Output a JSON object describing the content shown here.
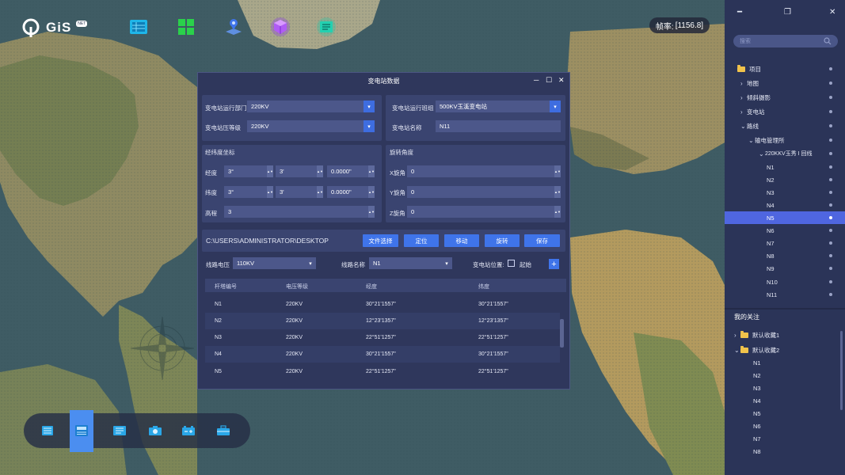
{
  "app": {
    "logo_text": "GiS",
    "logo_tag": "NET",
    "fps_label": "帧率:",
    "fps_value": "[1156.8]"
  },
  "top_icons": [
    "layers-icon",
    "grid-icon",
    "map-pin-icon",
    "cube-icon",
    "document-icon"
  ],
  "colors": {
    "accent": "#3f74ea",
    "selected": "#4f66e0",
    "sidebar_bg": "#2b3458",
    "dialog_bg": "#2f375c",
    "folder": "#f1c34b"
  },
  "sidebar": {
    "search_placeholder": "搜索",
    "tree": [
      {
        "label": "项目",
        "kind": "folder",
        "chev": ""
      },
      {
        "label": "地图",
        "kind": "node",
        "chev": "›"
      },
      {
        "label": "倾斜摄影",
        "kind": "node",
        "chev": "›"
      },
      {
        "label": "变电站",
        "kind": "node",
        "chev": "›"
      },
      {
        "label": "路线",
        "kind": "node",
        "chev": "⌄"
      },
      {
        "label": "输电管理所",
        "kind": "node",
        "chev": "⌄"
      },
      {
        "label": "220KKV玉秀 I 回线",
        "kind": "node",
        "chev": "⌄"
      },
      {
        "label": "N1",
        "kind": "leaf",
        "chev": ""
      },
      {
        "label": "N2",
        "kind": "leaf",
        "chev": ""
      },
      {
        "label": "N3",
        "kind": "leaf",
        "chev": ""
      },
      {
        "label": "N4",
        "kind": "leaf",
        "chev": ""
      },
      {
        "label": "N5",
        "kind": "leaf",
        "chev": "",
        "selected": true
      },
      {
        "label": "N6",
        "kind": "leaf",
        "chev": ""
      },
      {
        "label": "N7",
        "kind": "leaf",
        "chev": ""
      },
      {
        "label": "N8",
        "kind": "leaf",
        "chev": ""
      },
      {
        "label": "N9",
        "kind": "leaf",
        "chev": ""
      },
      {
        "label": "N10",
        "kind": "leaf",
        "chev": ""
      },
      {
        "label": "N11",
        "kind": "leaf",
        "chev": ""
      }
    ],
    "follow_title": "我的关注",
    "follow": [
      {
        "label": "默认收藏1",
        "chev": "›",
        "folder": true
      },
      {
        "label": "默认收藏2",
        "chev": "⌄",
        "folder": true
      },
      {
        "label": "N1"
      },
      {
        "label": "N2"
      },
      {
        "label": "N3"
      },
      {
        "label": "N4"
      },
      {
        "label": "N5"
      },
      {
        "label": "N6"
      },
      {
        "label": "N7"
      },
      {
        "label": "N8"
      }
    ]
  },
  "dialog": {
    "title": "变电站数据",
    "dept_label": "变电站运行部门",
    "dept_value": "220KV",
    "voltage_label": "变电站压等级",
    "voltage_value": "220KV",
    "team_label": "变电站运行班组",
    "team_value": "500KV玉溪变电站",
    "name_label": "变电站名称",
    "name_value": "N11",
    "coord_title": "经纬度坐标",
    "lon_label": "经度",
    "lon": [
      "3°",
      "3'",
      "0.0000\""
    ],
    "lat_label": "纬度",
    "lat": [
      "3°",
      "3'",
      "0.0000\""
    ],
    "alt_label": "高程",
    "alt_value": "3",
    "rot_title": "旋转角度",
    "rx_label": "X旋角",
    "rx_value": "0",
    "ry_label": "Y旋角",
    "ry_value": "0",
    "rz_label": "Z旋角",
    "rz_value": "0",
    "path": "C:\\USERS\\ADMINISTRATOR\\DESKTOP",
    "buttons": [
      "文件选择",
      "定位",
      "移动",
      "旋转",
      "保存"
    ],
    "line_voltage_label": "线路电压",
    "line_voltage_value": "110KV",
    "line_name_label": "线路名称",
    "line_name_value": "N1",
    "position_label": "变电站位置:",
    "start_label": "起始",
    "table": {
      "headers": [
        "杆塔编号",
        "电压等级",
        "经度",
        "纬度"
      ],
      "rows": [
        [
          "N1",
          "220KV",
          "30°21'1557\"",
          "30°21'1557\""
        ],
        [
          "N2",
          "220KV",
          "12°23'1357\"",
          "12°23'1357\""
        ],
        [
          "N3",
          "220KV",
          "22°51'1257\"",
          "22°51'1257\""
        ],
        [
          "N4",
          "220KV",
          "30°21'1557\"",
          "30°21'1557\""
        ],
        [
          "N5",
          "220KV",
          "22°51'1257\"",
          "22°51'1257\""
        ]
      ]
    }
  },
  "dock_icons": [
    "list-icon",
    "stack-icon",
    "menu-list-icon",
    "camera-icon",
    "battery-icon",
    "toolbox-icon"
  ]
}
